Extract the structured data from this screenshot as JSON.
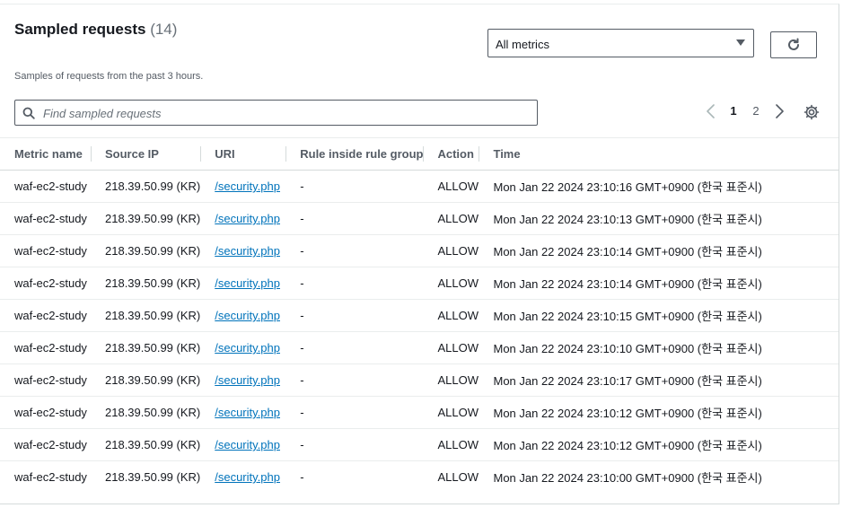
{
  "header": {
    "title": "Sampled requests",
    "count": "(14)",
    "description": "Samples of requests from the past 3 hours."
  },
  "metric_select": {
    "value": "All metrics"
  },
  "refresh": {
    "icon": "refresh-icon"
  },
  "search": {
    "placeholder": "Find sampled requests",
    "value": ""
  },
  "pagination": {
    "current": "1",
    "pages": [
      "1",
      "2"
    ]
  },
  "table": {
    "columns": [
      "Metric name",
      "Source IP",
      "URI",
      "Rule inside rule group",
      "Action",
      "Time"
    ],
    "rows": [
      {
        "metric": "waf-ec2-study",
        "ip": "218.39.50.99 (KR)",
        "uri": "/security.php",
        "rule": "-",
        "action": "ALLOW",
        "time": "Mon Jan 22 2024 23:10:16 GMT+0900 (한국 표준시)"
      },
      {
        "metric": "waf-ec2-study",
        "ip": "218.39.50.99 (KR)",
        "uri": "/security.php",
        "rule": "-",
        "action": "ALLOW",
        "time": "Mon Jan 22 2024 23:10:13 GMT+0900 (한국 표준시)"
      },
      {
        "metric": "waf-ec2-study",
        "ip": "218.39.50.99 (KR)",
        "uri": "/security.php",
        "rule": "-",
        "action": "ALLOW",
        "time": "Mon Jan 22 2024 23:10:14 GMT+0900 (한국 표준시)"
      },
      {
        "metric": "waf-ec2-study",
        "ip": "218.39.50.99 (KR)",
        "uri": "/security.php",
        "rule": "-",
        "action": "ALLOW",
        "time": "Mon Jan 22 2024 23:10:14 GMT+0900 (한국 표준시)"
      },
      {
        "metric": "waf-ec2-study",
        "ip": "218.39.50.99 (KR)",
        "uri": "/security.php",
        "rule": "-",
        "action": "ALLOW",
        "time": "Mon Jan 22 2024 23:10:15 GMT+0900 (한국 표준시)"
      },
      {
        "metric": "waf-ec2-study",
        "ip": "218.39.50.99 (KR)",
        "uri": "/security.php",
        "rule": "-",
        "action": "ALLOW",
        "time": "Mon Jan 22 2024 23:10:10 GMT+0900 (한국 표준시)"
      },
      {
        "metric": "waf-ec2-study",
        "ip": "218.39.50.99 (KR)",
        "uri": "/security.php",
        "rule": "-",
        "action": "ALLOW",
        "time": "Mon Jan 22 2024 23:10:17 GMT+0900 (한국 표준시)"
      },
      {
        "metric": "waf-ec2-study",
        "ip": "218.39.50.99 (KR)",
        "uri": "/security.php",
        "rule": "-",
        "action": "ALLOW",
        "time": "Mon Jan 22 2024 23:10:12 GMT+0900 (한국 표준시)"
      },
      {
        "metric": "waf-ec2-study",
        "ip": "218.39.50.99 (KR)",
        "uri": "/security.php",
        "rule": "-",
        "action": "ALLOW",
        "time": "Mon Jan 22 2024 23:10:12 GMT+0900 (한국 표준시)"
      },
      {
        "metric": "waf-ec2-study",
        "ip": "218.39.50.99 (KR)",
        "uri": "/security.php",
        "rule": "-",
        "action": "ALLOW",
        "time": "Mon Jan 22 2024 23:10:00 GMT+0900 (한국 표준시)"
      }
    ]
  }
}
